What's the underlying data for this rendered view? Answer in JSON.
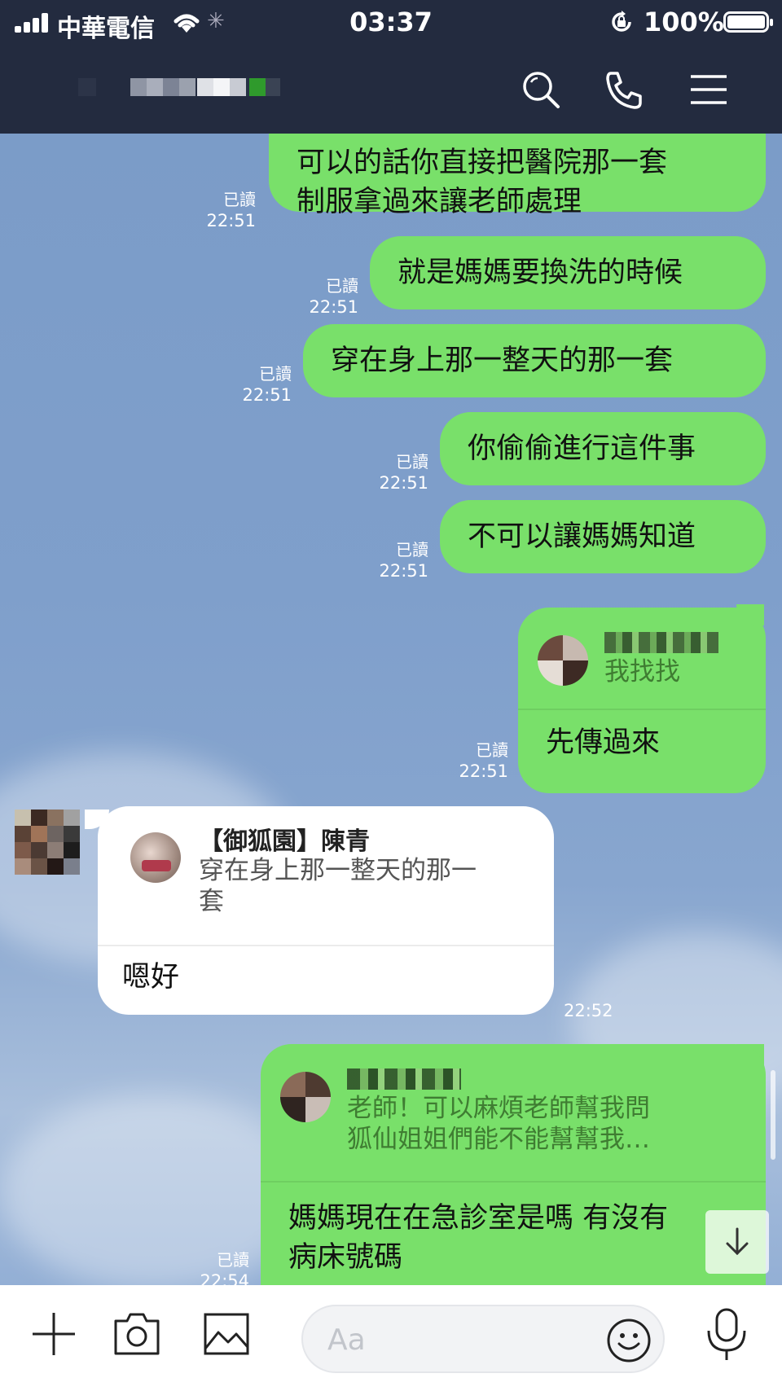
{
  "status_bar": {
    "carrier": "中華電信",
    "time": "03:37",
    "battery": "100%"
  },
  "header": {
    "icons": [
      "search-icon",
      "phone-icon",
      "menu-icon"
    ]
  },
  "messages": [
    {
      "text_1": "可以的話你直接把醫院那一套",
      "text_2": "制服拿過來讓老師處理",
      "read": "已讀",
      "time": "22:51"
    },
    {
      "text": "就是媽媽要換洗的時候",
      "read": "已讀",
      "time": "22:51"
    },
    {
      "text": "穿在身上那一整天的那一套",
      "read": "已讀",
      "time": "22:51"
    },
    {
      "text": "你偷偷進行這件事",
      "read": "已讀",
      "time": "22:51"
    },
    {
      "text": "不可以讓媽媽知道",
      "read": "已讀",
      "time": "22:51"
    },
    {
      "quote_text": "我找找",
      "text": "先傳過來",
      "read": "已讀",
      "time": "22:51"
    },
    {
      "quote_name": "【御狐園】陳青",
      "quote_text_1": "穿在身上那一整天的那一",
      "quote_text_2": "套",
      "text": "嗯好",
      "time": "22:52"
    },
    {
      "quote_text_1": "老師！可以麻煩老師幫我問",
      "quote_text_2": "狐仙姐姐們能不能幫幫我…",
      "text_1": "媽媽現在在急診室是嗎 有沒有",
      "text_2": "病床號碼",
      "read": "已讀",
      "time": "22:54"
    }
  ],
  "composer": {
    "placeholder": "Aa",
    "icons": [
      "plus-icon",
      "camera-icon",
      "image-icon",
      "emoji-icon",
      "mic-icon"
    ]
  },
  "colors": {
    "header_bg": "#232b3f",
    "bubble_out": "#79e06a",
    "bubble_in": "#ffffff",
    "chat_bg": "#7f9fc9"
  }
}
